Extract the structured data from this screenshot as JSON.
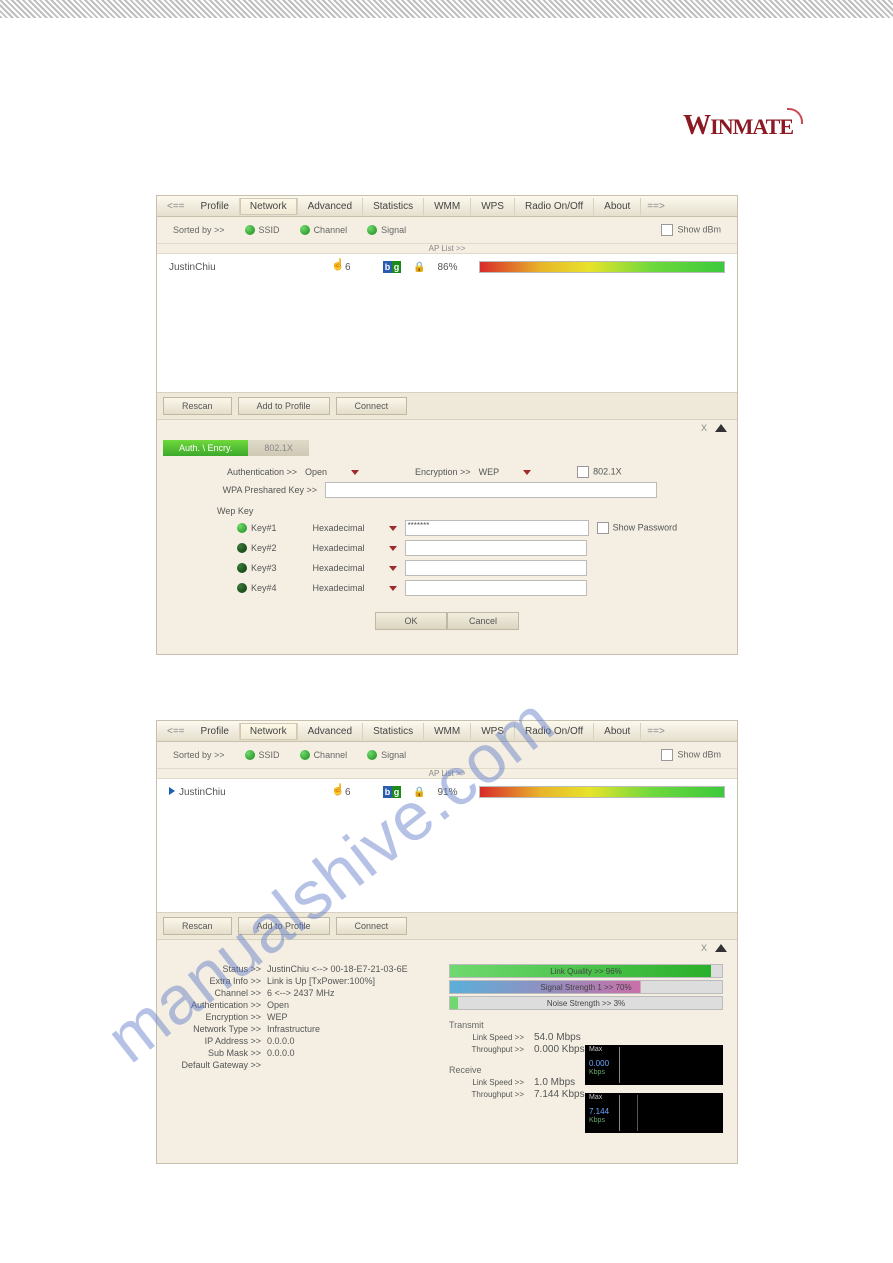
{
  "brand": "WINMATE",
  "tabs": {
    "prev": "<==",
    "profile": "Profile",
    "network": "Network",
    "advanced": "Advanced",
    "statistics": "Statistics",
    "wmm": "WMM",
    "wps": "WPS",
    "radio": "Radio On/Off",
    "about": "About",
    "next": "==>"
  },
  "sort": {
    "label": "Sorted by >>",
    "ssid": "SSID",
    "channel": "Channel",
    "signal": "Signal",
    "showdbm": "Show dBm",
    "aplist": "AP List >>"
  },
  "ap1": {
    "ssid": "JustinChiu",
    "ch": "6",
    "pct": "86%"
  },
  "ap2": {
    "ssid": "JustinChiu",
    "ch": "6",
    "pct": "91%"
  },
  "btns": {
    "rescan": "Rescan",
    "addprofile": "Add to Profile",
    "connect": "Connect"
  },
  "close": {
    "x": "X"
  },
  "subtabs": {
    "auth": "Auth. \\ Encry.",
    "x8021": "802.1X"
  },
  "auth": {
    "authlbl": "Authentication >>",
    "authval": "Open",
    "enclbl": "Encryption >>",
    "encval": "WEP",
    "x8021": "802.1X",
    "psklbl": "WPA Preshared Key >>",
    "weptitle": "Wep Key",
    "k1": "Key#1",
    "k2": "Key#2",
    "k3": "Key#3",
    "k4": "Key#4",
    "hex": "Hexadecimal",
    "k1val": "*******",
    "showpw": "Show Password",
    "ok": "OK",
    "cancel": "Cancel"
  },
  "status": {
    "status_l": "Status >>",
    "status_v": "JustinChiu <--> 00-18-E7-21-03-6E",
    "extra_l": "Extra Info >>",
    "extra_v": "Link is Up [TxPower:100%]",
    "ch_l": "Channel >>",
    "ch_v": "6 <--> 2437 MHz",
    "auth_l": "Authentication >>",
    "auth_v": "Open",
    "enc_l": "Encryption >>",
    "enc_v": "WEP",
    "nt_l": "Network Type >>",
    "nt_v": "Infrastructure",
    "ip_l": "IP Address >>",
    "ip_v": "0.0.0.0",
    "mask_l": "Sub Mask >>",
    "mask_v": "0.0.0.0",
    "gw_l": "Default Gateway >>",
    "gw_v": ""
  },
  "quality": {
    "link": "Link Quality >> 96%",
    "signal": "Signal Strength 1 >> 70%",
    "noise": "Noise Strength >> 3%"
  },
  "tx": {
    "hdr": "Transmit",
    "ls_l": "Link Speed >>",
    "ls_v": "54.0 Mbps",
    "tp_l": "Throughput >>",
    "tp_v": "0.000 Kbps",
    "max": "Max",
    "boxval": "0.000",
    "boxunit": "Kbps"
  },
  "rx": {
    "hdr": "Receive",
    "ls_l": "Link Speed >>",
    "ls_v": "1.0 Mbps",
    "tp_l": "Throughput >>",
    "tp_v": "7.144 Kbps",
    "max": "Max",
    "boxval": "7.144",
    "boxunit": "Kbps"
  },
  "watermark": "manualshive.com"
}
